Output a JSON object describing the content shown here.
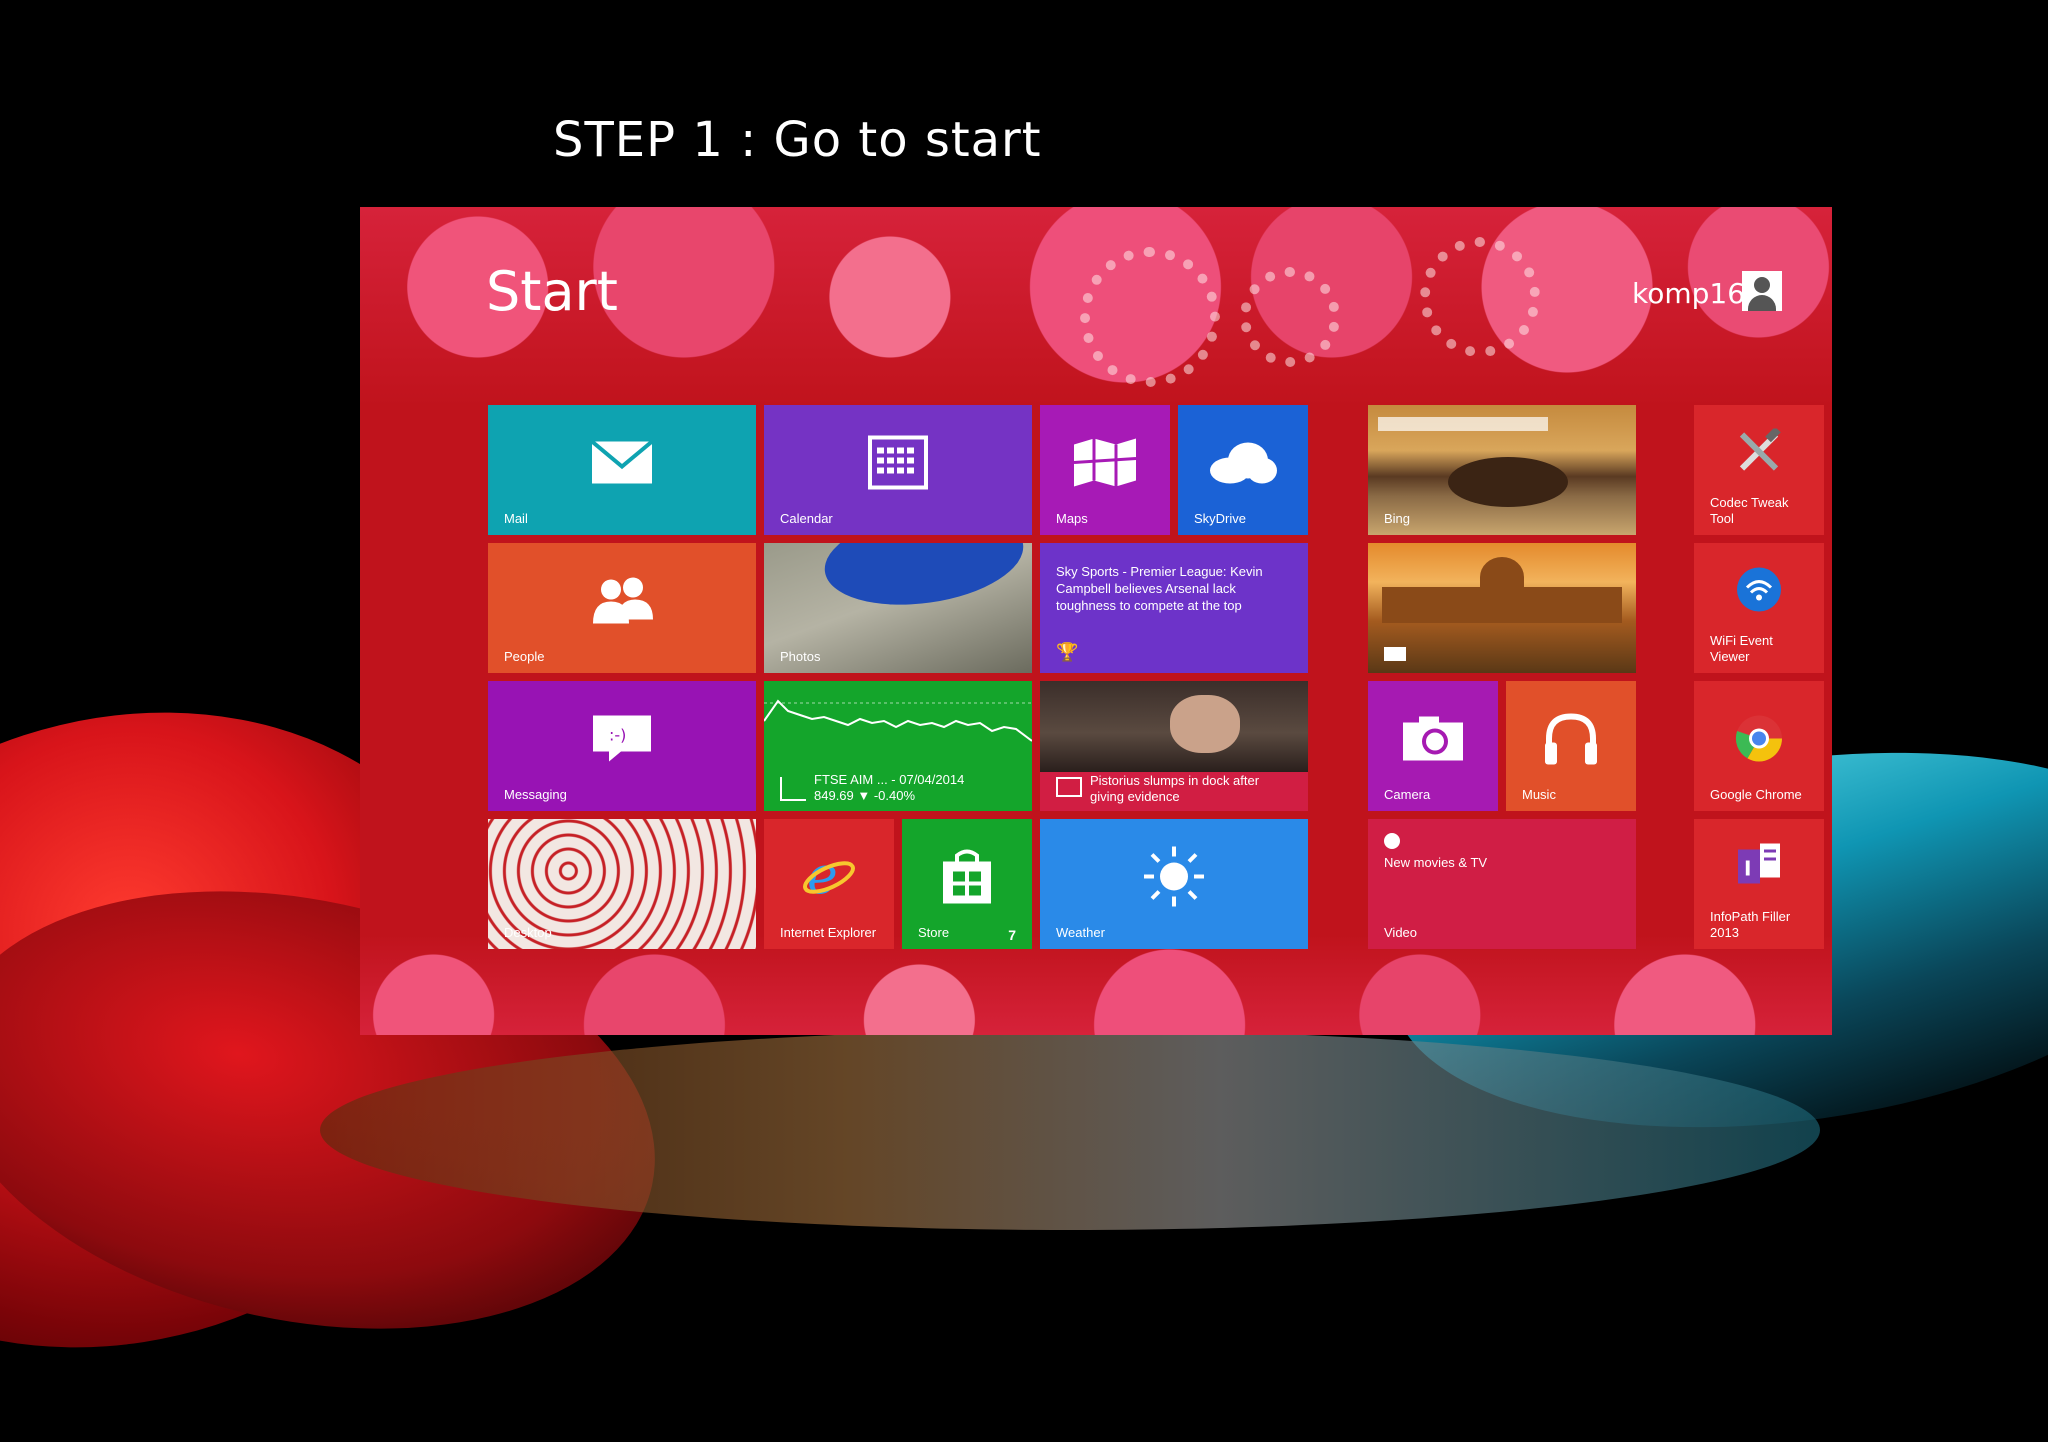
{
  "slide": {
    "title": "STEP 1 : Go to start"
  },
  "start": {
    "title": "Start",
    "user": "komp16"
  },
  "tiles": {
    "mail": {
      "label": "Mail"
    },
    "calendar": {
      "label": "Calendar"
    },
    "maps": {
      "label": "Maps"
    },
    "skydrive": {
      "label": "SkyDrive"
    },
    "bing": {
      "label": "Bing"
    },
    "codec": {
      "label": "Codec Tweak Tool"
    },
    "people": {
      "label": "People"
    },
    "photos": {
      "label": "Photos"
    },
    "sports": {
      "headline": "Sky Sports - Premier League: Kevin Campbell believes Arsenal lack toughness to compete at the top"
    },
    "wifi": {
      "label": "WiFi Event Viewer"
    },
    "messaging": {
      "label": "Messaging"
    },
    "finance": {
      "line1": "FTSE AIM ... - 07/04/2014",
      "line2": "849.69 ▼ -0.40%"
    },
    "news": {
      "headline": "Pistorius slumps in dock after giving evidence"
    },
    "camera": {
      "label": "Camera"
    },
    "music": {
      "label": "Music"
    },
    "chrome": {
      "label": "Google Chrome"
    },
    "desktop": {
      "label": "Desktop"
    },
    "ie": {
      "label": "Internet Explorer"
    },
    "store": {
      "label": "Store",
      "badge": "7"
    },
    "weather": {
      "label": "Weather"
    },
    "video": {
      "label": "Video",
      "subtitle": "New movies & TV"
    },
    "infopath": {
      "label": "InfoPath Filler 2013"
    }
  },
  "colors": {
    "start_bg": "#c0131c",
    "mail": "#0ea3b1",
    "calendar": "#7533c4",
    "maps": "#a71ab6",
    "skydrive": "#1b62d6",
    "people": "#e1502a",
    "sports": "#6d33c9",
    "messaging": "#9813b4",
    "finance": "#14a52b",
    "news": "#d11e43",
    "camera": "#a61ab2",
    "music": "#e1502a",
    "desktop_tile": "#c62126",
    "ie": "#d9262b",
    "store": "#14a52b",
    "weather": "#2a8ae8",
    "video": "#d01e45"
  }
}
